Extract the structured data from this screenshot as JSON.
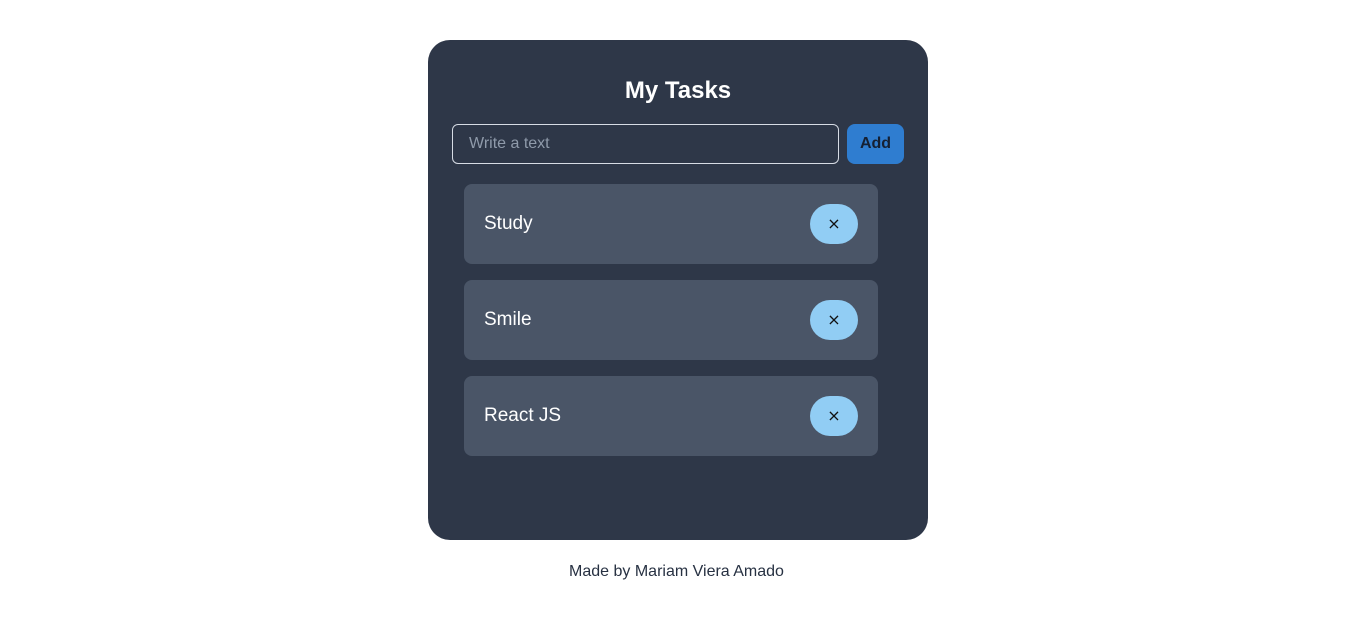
{
  "app": {
    "title": "My Tasks"
  },
  "form": {
    "input_value": "",
    "input_placeholder": "Write a text",
    "add_label": "Add"
  },
  "tasks": [
    {
      "label": "Study",
      "remove_label": "×"
    },
    {
      "label": "Smile",
      "remove_label": "×"
    },
    {
      "label": "React JS",
      "remove_label": "×"
    }
  ],
  "footer": {
    "text": "Made by Mariam Viera Amado"
  },
  "colors": {
    "page_background": "#ffffff",
    "card_background": "#2e3748",
    "task_background": "#4a5567",
    "add_button": "#2f7dd0",
    "remove_button": "#91cdf4"
  },
  "icons": {
    "remove": "close-icon"
  }
}
